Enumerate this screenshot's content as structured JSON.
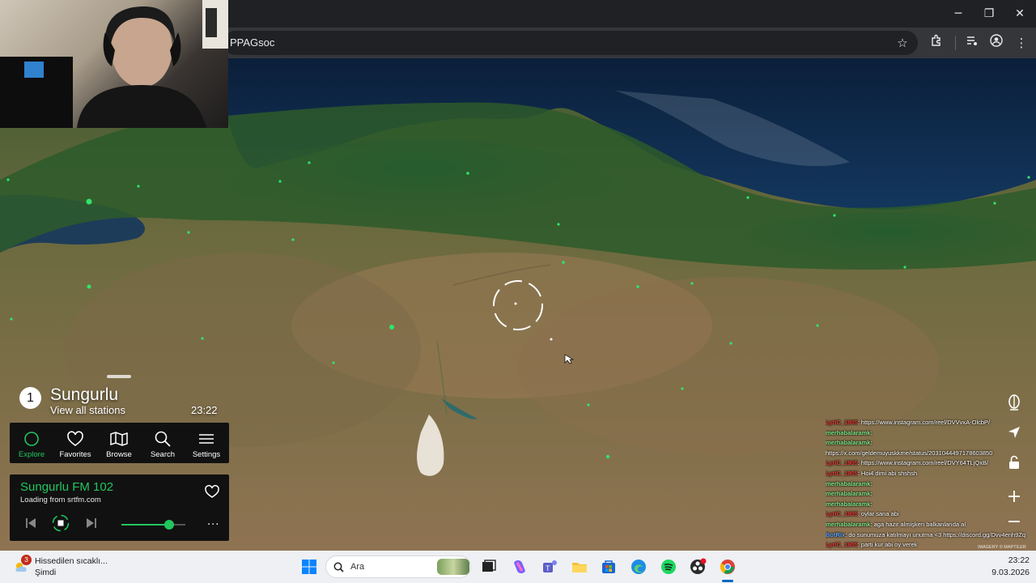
{
  "browser": {
    "url": "PPAGsoc",
    "window_controls": {
      "minimize": "─",
      "maximize": "❐",
      "close": "✕"
    },
    "toolbar_icons": [
      "bookmark-star-icon",
      "extensions-icon",
      "media-control-icon",
      "profile-icon",
      "menu-icon"
    ]
  },
  "station": {
    "number": "1",
    "name": "Sungurlu",
    "view_all": "View all stations",
    "time": "23:22"
  },
  "nav": {
    "items": [
      {
        "label": "Explore",
        "icon": "explore-circle-icon",
        "active": true
      },
      {
        "label": "Favorites",
        "icon": "heart-icon",
        "active": false
      },
      {
        "label": "Browse",
        "icon": "map-icon",
        "active": false
      },
      {
        "label": "Search",
        "icon": "search-icon",
        "active": false
      },
      {
        "label": "Settings",
        "icon": "menu-lines-icon",
        "active": false
      }
    ],
    "accent": "#22c55e"
  },
  "player": {
    "title": "Sungurlu FM 102",
    "status": "Loading from srtfm.com",
    "volume": 0.75,
    "more": "···"
  },
  "chat": {
    "rows": [
      {
        "user": "LyriC_1905",
        "text": ": https://www.instagram.com/reel/DVVvxA-OlcbP/",
        "user_color": "#e53935"
      },
      {
        "user": "merhabalaramk",
        "text": ": ",
        "user_color": "#7ee787"
      },
      {
        "user": "merhabalaramk",
        "text": ":",
        "user_color": "#7ee787"
      },
      {
        "user": "",
        "text": "https://x.com/geldemuyuskkme/status/2031044497178603850",
        "user_color": "#ffffff"
      },
      {
        "user": "LyriC_1905",
        "text": ": https://www.instagram.com/reel/DVY64TLjQxB/",
        "user_color": "#e53935"
      },
      {
        "user": "LyriC_1905",
        "text": ": Hoi4 dimi abi shshsh",
        "user_color": "#e53935"
      },
      {
        "user": "merhabalaramk",
        "text": ": ",
        "user_color": "#7ee787"
      },
      {
        "user": "merhabalaramk",
        "text": ": ",
        "user_color": "#7ee787"
      },
      {
        "user": "merhabalaramk",
        "text": ": ",
        "user_color": "#7ee787"
      },
      {
        "user": "LyriC_1905",
        "text": ": oylar sana abi",
        "user_color": "#e53935"
      },
      {
        "user": "merhabalaramk",
        "text": ": aga hazir almişken balkanlarıda al",
        "user_color": "#7ee787"
      },
      {
        "user": "BotRix",
        "text": ": do sunumuza katılmayı unutma <3 https://discord.gg/Dvv4enh9Zq",
        "user_color": "#60a5fa"
      },
      {
        "user": "LyriC_1905",
        "text": ": parti kur abi oy verek",
        "user_color": "#e53935"
      }
    ]
  },
  "map": {
    "attribution": "IMAGERY © MAPTILER",
    "controls": [
      "globe-icon",
      "locate-arrow-icon",
      "lock-icon",
      "zoom-in-icon",
      "zoom-out-icon"
    ]
  },
  "taskbar": {
    "weather_badge": "3",
    "weather_line1": "Hissedilen sıcaklı...",
    "weather_line2": "Şimdi",
    "search_placeholder": "Ara",
    "time": "23:22",
    "date": "9.03.2026"
  }
}
